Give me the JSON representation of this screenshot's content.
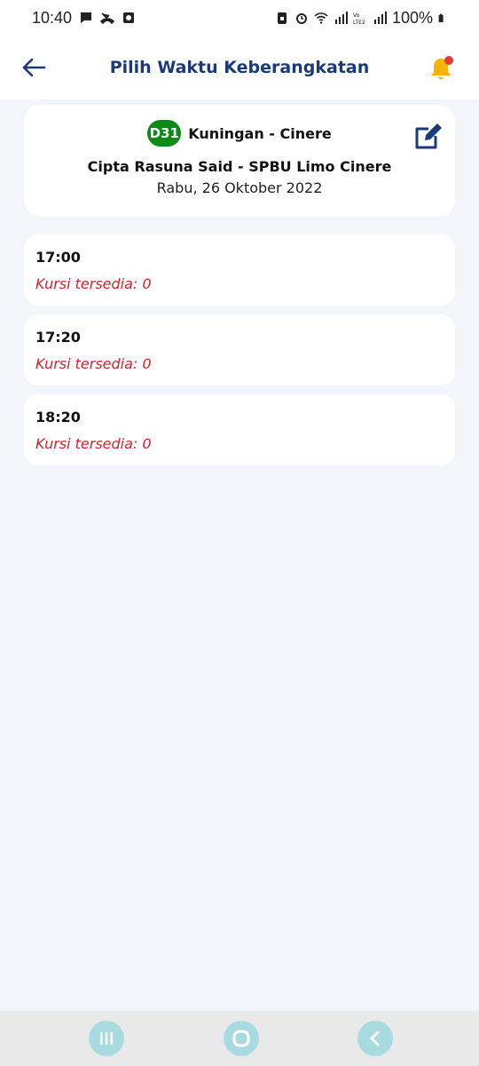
{
  "status_bar": {
    "time": "10:40",
    "battery": "100%"
  },
  "header": {
    "title": "Pilih Waktu Keberangkatan",
    "accent_color": "#1a3a7a",
    "notification_dot_color": "#e53935"
  },
  "route": {
    "badge": "D31",
    "badge_color": "#0c8a16",
    "name": "Kuningan - Cinere",
    "stops": "Cipta Rasuna Said - SPBU Limo Cinere",
    "date": "Rabu, 26 Oktober 2022"
  },
  "departures": [
    {
      "time": "17:00",
      "seats": "Kursi tersedia: 0"
    },
    {
      "time": "17:20",
      "seats": "Kursi tersedia: 0"
    },
    {
      "time": "18:20",
      "seats": "Kursi tersedia: 0"
    }
  ]
}
